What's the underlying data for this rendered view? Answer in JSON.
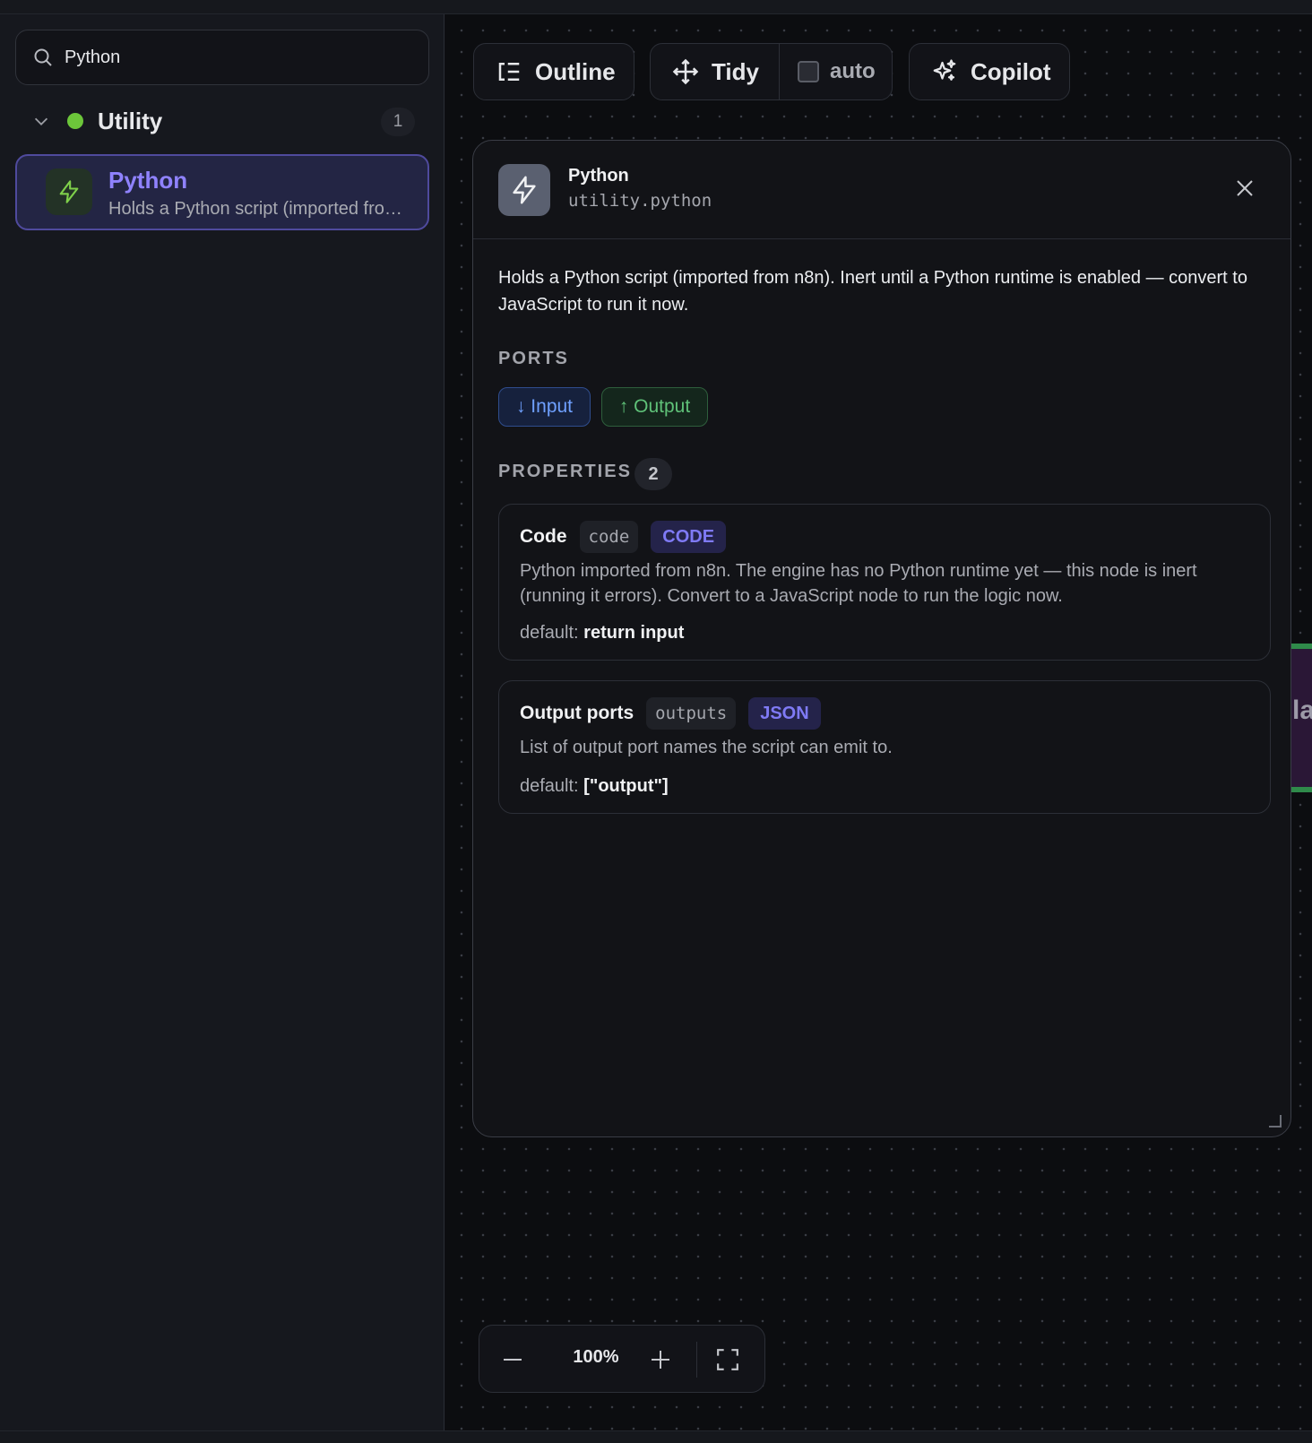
{
  "sidebar": {
    "search": {
      "value": "Python",
      "icon": "search-icon"
    },
    "group": {
      "label": "Utility",
      "count": "1",
      "dot_color": "#6cc63a"
    },
    "node": {
      "title": "Python",
      "description": "Holds a Python script (imported fro…",
      "icon": "lightning-icon"
    }
  },
  "toolbar": {
    "outline_label": "Outline",
    "tidy_label": "Tidy",
    "auto_label": "auto",
    "copilot_label": "Copilot"
  },
  "canvas": {
    "peek_text": "la"
  },
  "panel": {
    "title": "Python",
    "type_id": "utility.python",
    "description": "Holds a Python script (imported from n8n). Inert until a Python runtime is enabled — convert to JavaScript to run it now.",
    "ports_label": "PORTS",
    "ports": {
      "input": "↓ Input",
      "output": "↑ Output"
    },
    "properties_label": "PROPERTIES",
    "properties_count": "2",
    "properties": [
      {
        "name": "Code",
        "key": "code",
        "type": "CODE",
        "description": "Python imported from n8n. The engine has no Python runtime yet — this node is inert (running it errors). Convert to a JavaScript node to run the logic now.",
        "default_label": "default:",
        "default_value": "return input"
      },
      {
        "name": "Output ports",
        "key": "outputs",
        "type": "JSON",
        "description": "List of output port names the script can emit to.",
        "default_label": "default:",
        "default_value": "[\"output\"]"
      }
    ]
  },
  "zoom": {
    "value": "100%"
  },
  "colors": {
    "accent": "#8f82ff",
    "input_port": "#6fa0ff",
    "output_port": "#5fc178"
  }
}
